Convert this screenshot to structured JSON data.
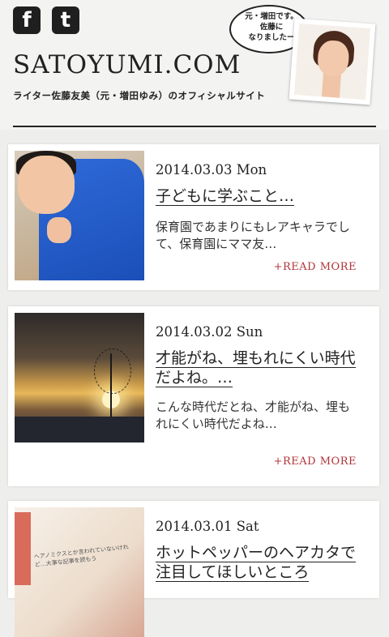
{
  "header": {
    "social": [
      {
        "name": "facebook-icon",
        "glyph": "f"
      },
      {
        "name": "twitter-icon",
        "glyph": "t"
      }
    ],
    "site_title": "SATOYUMI.COM",
    "tagline": "ライター佐藤友美（元・増田ゆみ）のオフィシャルサイト",
    "bubble": "元・増田です。\n佐藤に\nなりましたー"
  },
  "posts": [
    {
      "date": "2014.03.03 Mon",
      "title": "子どもに学ぶこと…",
      "excerpt": "保育園であまりにもレアキャラでして、保育園にママ友…",
      "read_more": "+READ MORE"
    },
    {
      "date": "2014.03.02 Sun",
      "title": "才能がね、埋もれにくい時代だよね。…",
      "excerpt": "こんな時代だとね、才能がね、埋もれにくい時代だよね…",
      "read_more": "+READ MORE"
    },
    {
      "date": "2014.03.01 Sat",
      "title": "ホットペッパーのヘアカタで注目してほしいところ",
      "thumb_text": "ヘアノミクスとか言われていないけれど…大事な記事を読もう"
    }
  ],
  "colors": {
    "accent": "#b0343a",
    "background": "#eeeeec",
    "card": "#ffffff"
  }
}
